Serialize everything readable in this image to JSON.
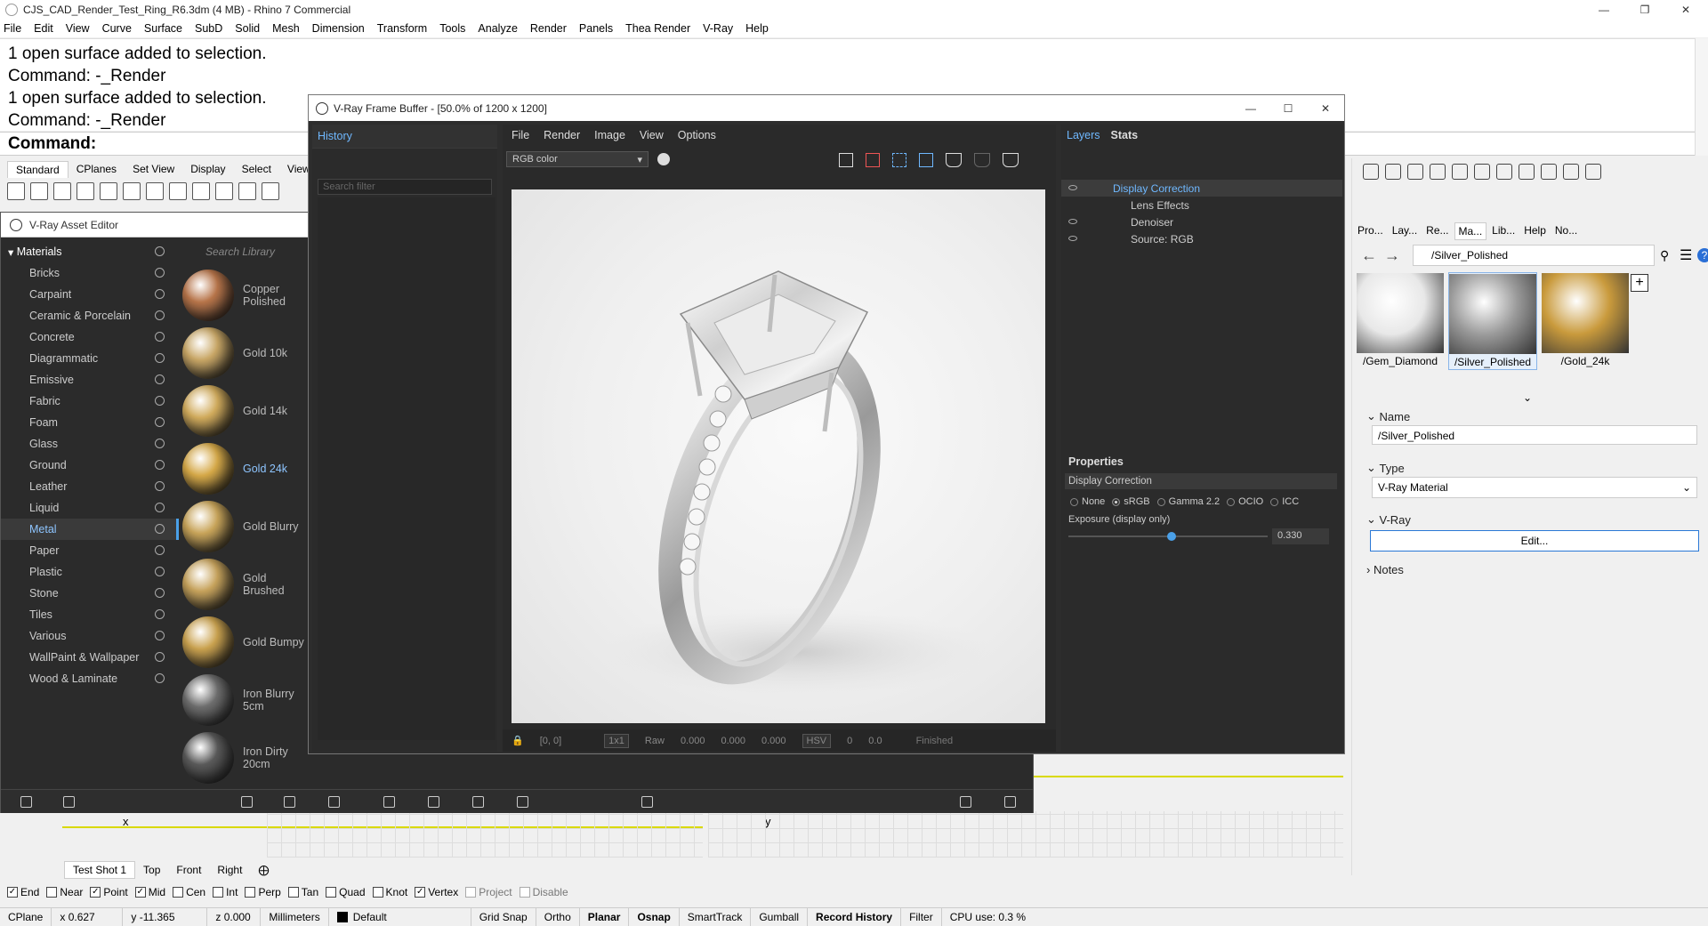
{
  "window": {
    "title": "CJS_CAD_Render_Test_Ring_R6.3dm (4 MB) - Rhino 7 Commercial"
  },
  "menu": [
    "File",
    "Edit",
    "View",
    "Curve",
    "Surface",
    "SubD",
    "Solid",
    "Mesh",
    "Dimension",
    "Transform",
    "Tools",
    "Analyze",
    "Render",
    "Panels",
    "Thea Render",
    "V-Ray",
    "Help"
  ],
  "command_history": [
    "1 open surface added to selection.",
    "Command: -_Render",
    "1 open surface added to selection.",
    "Command: -_Render"
  ],
  "command_prompt": "Command:",
  "toolbar_tabs": [
    "Standard",
    "CPlanes",
    "Set View",
    "Display",
    "Select",
    "View"
  ],
  "asset_editor": {
    "title": "V-Ray Asset Editor",
    "search_placeholder": "Search Library",
    "categories_header": "Materials",
    "categories": [
      "Bricks",
      "Carpaint",
      "Ceramic & Porcelain",
      "Concrete",
      "Diagrammatic",
      "Emissive",
      "Fabric",
      "Foam",
      "Glass",
      "Ground",
      "Leather",
      "Liquid",
      "Metal",
      "Paper",
      "Plastic",
      "Stone",
      "Tiles",
      "Various",
      "WallPaint & Wallpaper",
      "Wood & Laminate"
    ],
    "selected_category": "Metal",
    "materials": [
      {
        "name": "Copper Polished",
        "color": "#b8754a"
      },
      {
        "name": "Gold 10k",
        "color": "#c9a766"
      },
      {
        "name": "Gold 14k",
        "color": "#d1ab5c"
      },
      {
        "name": "Gold 24k",
        "color": "#d6a948"
      },
      {
        "name": "Gold Blurry",
        "color": "#c9a55a"
      },
      {
        "name": "Gold Brushed",
        "color": "#c7a35c"
      },
      {
        "name": "Gold Bumpy",
        "color": "#caa24f"
      },
      {
        "name": "Iron Blurry 5cm",
        "color": "#6e6e6e"
      },
      {
        "name": "Iron Dirty 20cm",
        "color": "#5a5a5a"
      }
    ],
    "selected_material": "Gold 24k"
  },
  "vfb": {
    "title": "V-Ray Frame Buffer - [50.0% of 1200 x 1200]",
    "history_tab": "History",
    "history_search_placeholder": "Search filter",
    "menu": [
      "File",
      "Render",
      "Image",
      "View",
      "Options"
    ],
    "channel": "RGB color",
    "layers_tab": "Layers",
    "stats_tab": "Stats",
    "layers": [
      {
        "name": "Display Correction",
        "selected": true
      },
      {
        "name": "Lens Effects",
        "selected": false
      },
      {
        "name": "Denoiser",
        "selected": false
      },
      {
        "name": "Source: RGB",
        "selected": false
      }
    ],
    "properties_title": "Properties",
    "properties_section": "Display Correction",
    "color_modes": [
      "None",
      "sRGB",
      "Gamma 2.2",
      "OCIO",
      "ICC"
    ],
    "selected_mode": "sRGB",
    "exposure_label": "Exposure (display only)",
    "exposure_value": "0.330",
    "exposure_fraction": 0.52,
    "footer": {
      "coords": "[0, 0]",
      "sample": "1x1",
      "raw": "Raw",
      "r": "0.000",
      "g": "0.000",
      "b": "0.000",
      "colorspace": "HSV",
      "h": "0",
      "v": "0.0",
      "status": "Finished"
    }
  },
  "material_panel": {
    "tabs": [
      "Pro...",
      "Lay...",
      "Re...",
      "Ma...",
      "Lib...",
      "Help",
      "No..."
    ],
    "path": "/Silver_Polished",
    "thumbs": [
      {
        "name": "/Gem_Diamond",
        "color": "#e8e8e8"
      },
      {
        "name": "/Silver_Polished",
        "color": "#9a9a9a"
      },
      {
        "name": "/Gold_24k",
        "color": "#c99a3c"
      }
    ],
    "selected_thumb": "/Silver_Polished",
    "name_label": "Name",
    "name_value": "/Silver_Polished",
    "type_label": "Type",
    "type_value": "V-Ray Material",
    "vray_label": "V-Ray",
    "edit_button": "Edit...",
    "notes_label": "Notes"
  },
  "viewport_tabs": [
    "Test Shot 1",
    "Top",
    "Front",
    "Right"
  ],
  "osnaps": [
    {
      "label": "End",
      "checked": true
    },
    {
      "label": "Near",
      "checked": false
    },
    {
      "label": "Point",
      "checked": true
    },
    {
      "label": "Mid",
      "checked": true
    },
    {
      "label": "Cen",
      "checked": false
    },
    {
      "label": "Int",
      "checked": false
    },
    {
      "label": "Perp",
      "checked": false
    },
    {
      "label": "Tan",
      "checked": false
    },
    {
      "label": "Quad",
      "checked": false
    },
    {
      "label": "Knot",
      "checked": false
    },
    {
      "label": "Vertex",
      "checked": true
    },
    {
      "label": "Project",
      "checked": false
    },
    {
      "label": "Disable",
      "checked": false
    }
  ],
  "statusbar": {
    "cplane": "CPlane",
    "x": "x 0.627",
    "y": "y -11.365",
    "z": "z 0.000",
    "units": "Millimeters",
    "layer": "Default",
    "grid_snap": "Grid Snap",
    "ortho": "Ortho",
    "planar": "Planar",
    "osnap": "Osnap",
    "smarttrack": "SmartTrack",
    "gumball": "Gumball",
    "record_history": "Record History",
    "filter": "Filter",
    "cpu": "CPU use: 0.3 %"
  },
  "axis_labels": {
    "x": "x",
    "y": "y"
  }
}
